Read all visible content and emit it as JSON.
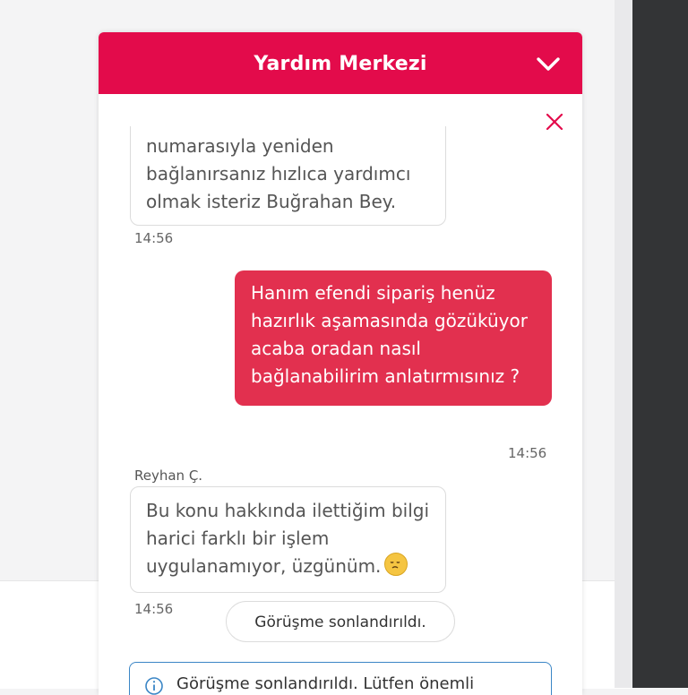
{
  "header": {
    "title": "Yardım Merkezi"
  },
  "messages": [
    {
      "text": "numarasıyla yeniden\nbağlanırsanız hızlıca yardımcı\nolmak isteriz Buğrahan Bey.",
      "time": "14:56"
    },
    {
      "text": "Hanım efendi sipariş henüz\nhazırlık aşamasında gözüküyor\nacaba oradan nasıl\nbağlanabilirim anlatırmısınız ?",
      "time": "14:56"
    },
    {
      "sender": "Reyhan Ç.",
      "text": "Bu konu hakkında ilettiğim bilgi\nharici farklı bir işlem\nuygulanamıyor, üzgünüm.",
      "emoji": "disappointed-face",
      "time": "14:56"
    }
  ],
  "status": {
    "ended_label": "Görüşme sonlandırıldı."
  },
  "notice": {
    "text": "Görüşme sonlandırıldı. Lütfen önemli"
  },
  "colors": {
    "brand": "#e30b4b",
    "user_bubble": "#e2304f",
    "notice_border": "#3b86c6"
  },
  "icons": {
    "collapse": "chevron-down-icon",
    "close": "close-icon",
    "info": "info-icon"
  }
}
